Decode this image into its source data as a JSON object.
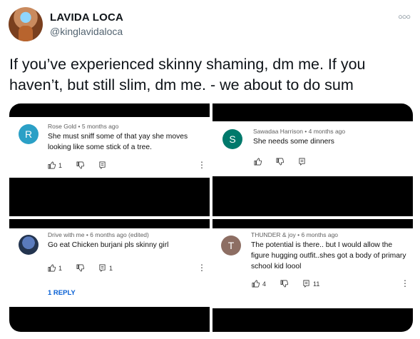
{
  "tweet": {
    "author_name": "LAVIDA LOCA",
    "author_handle": "@kinglavidaloca",
    "more_icon": "more-icon",
    "text": "If you’ve experienced skinny shaming, dm me. If you haven’t, but still slim, dm me. - we about to do sum"
  },
  "comments": [
    {
      "avatar_letter": "R",
      "avatar_color": "#2ba0c6",
      "meta": "Rose Gold • 5 months ago",
      "text": "She must sniff some of that yay she moves looking like some stick of a tree.",
      "likes": "1",
      "replies_count": ""
    },
    {
      "avatar_letter": "S",
      "avatar_color": "#00796b",
      "meta": "Sawadaa Harrison • 4 months ago",
      "text": "She needs some dinners",
      "likes": "",
      "replies_count": ""
    },
    {
      "avatar_letter": "",
      "avatar_color": "#3b4f7a",
      "meta": "Drive with me • 6 months ago (edited)",
      "text": "Go eat Chicken burjani pls skinny girl",
      "likes": "1",
      "replies_count": "1",
      "reply_link": "1 REPLY"
    },
    {
      "avatar_letter": "T",
      "avatar_color": "#8d6e63",
      "meta": "THUNDER & joy • 6 months ago",
      "text": "The potential is there.. but  I would allow the figure hugging outfit..shes got a body of primary school kid loool",
      "likes": "4",
      "replies_count": "11"
    }
  ]
}
